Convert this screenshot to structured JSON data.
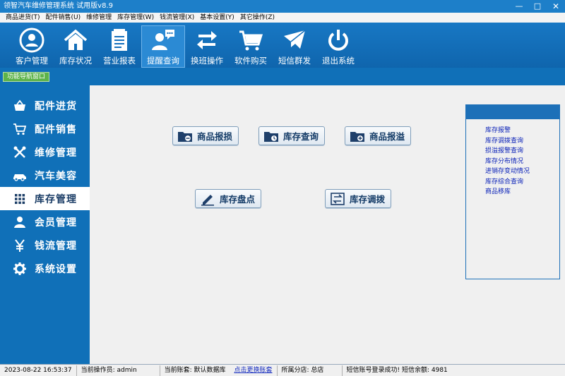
{
  "window": {
    "title": "领智汽车维修管理系统 试用版v8.9"
  },
  "menu": [
    "商品进货(T)",
    "配件销售(U)",
    "维修管理",
    "库存管理(W)",
    "钱流管理(X)",
    "基本设置(Y)",
    "其它操作(Z)"
  ],
  "toolbar": [
    {
      "label": "客户管理",
      "icon": "customer-icon"
    },
    {
      "label": "库存状况",
      "icon": "home-icon"
    },
    {
      "label": "营业报表",
      "icon": "report-icon"
    },
    {
      "label": "提醒查询",
      "icon": "reminder-icon"
    },
    {
      "label": "换班操作",
      "icon": "swap-icon"
    },
    {
      "label": "软件购买",
      "icon": "cart-icon"
    },
    {
      "label": "短信群发",
      "icon": "mail-icon"
    },
    {
      "label": "退出系统",
      "icon": "power-icon"
    }
  ],
  "nav_tab": {
    "label": "功能导航窗口"
  },
  "sidebar": [
    {
      "label": "配件进货",
      "icon": "basket-icon"
    },
    {
      "label": "配件销售",
      "icon": "cart-icon"
    },
    {
      "label": "维修管理",
      "icon": "tools-icon"
    },
    {
      "label": "汽车美容",
      "icon": "car-icon"
    },
    {
      "label": "库存管理",
      "icon": "grid-icon"
    },
    {
      "label": "会员管理",
      "icon": "user-icon"
    },
    {
      "label": "钱流管理",
      "icon": "yen-icon"
    },
    {
      "label": "系统设置",
      "icon": "gear-icon"
    }
  ],
  "actions": [
    {
      "label": "商品报损",
      "icon": "folder-minus-icon"
    },
    {
      "label": "库存查询",
      "icon": "folder-clock-icon"
    },
    {
      "label": "商品报溢",
      "icon": "folder-plus-icon"
    },
    {
      "label": "库存盘点",
      "icon": "pencil-icon"
    },
    {
      "label": "库存调拨",
      "icon": "transfer-icon"
    }
  ],
  "panel": {
    "links": [
      "库存报警",
      "库存调拨查询",
      "损溢报警查询",
      "库存分布情况",
      "进销存变动情况",
      "库存综合查询",
      "商品移库"
    ]
  },
  "status": {
    "datetime": "2023-08-22 16:53:37",
    "operator": "当前操作员: admin",
    "account": "当前账套: 默认数据库",
    "switch_link": "点击更换账套",
    "branch": "所属分店: 总店",
    "sms": "短信账号登录成功! 短信余额: 4981"
  }
}
